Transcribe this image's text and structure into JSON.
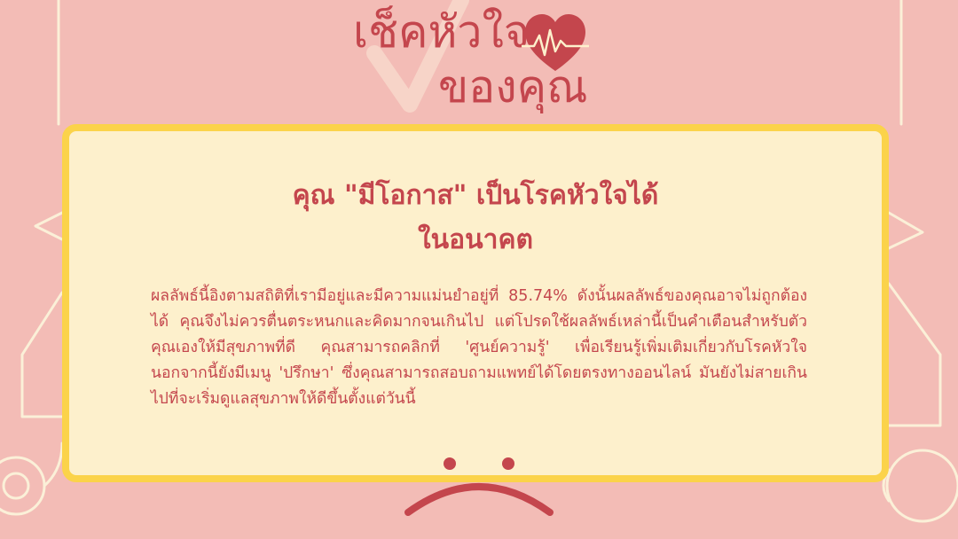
{
  "title": {
    "line1": "เช็คหัวใจ",
    "line2": "ของคุณ"
  },
  "result": {
    "headline_line1": "คุณ \"มีโอกาส\" เป็นโรคหัวใจได้",
    "headline_line2": "ในอนาคต",
    "body": "ผลลัพธ์นี้อิงตามสถิติที่เรามีอยู่และมีความแม่นยำอยู่ที่ 85.74% ดังนั้นผลลัพธ์ของคุณอาจไม่ถูกต้องได้ คุณจึงไม่ควรตื่นตระหนกและคิดมากจนเกินไป แต่โปรดใช้ผลลัพธ์เหล่านี้เป็นคำเตือนสำหรับตัวคุณเองให้มีสุขภาพที่ดี คุณสามารถคลิกที่ 'ศูนย์ความรู้' เพื่อเรียนรู้เพิ่มเติมเกี่ยวกับโรคหัวใจ นอกจากนี้ยังมีเมนู 'ปรึกษา' ซึ่งคุณสามารถสอบถามแพทย์ได้โดยตรงทางออนไลน์ มันยังไม่สายเกินไปที่จะเริ่มดูแลสุขภาพให้ดีขึ้นตั้งแต่วันนี้"
  },
  "icons": {
    "heart": "heart-pulse-icon",
    "check": "checkmark-icon",
    "face": "sad-face-icon"
  },
  "colors": {
    "background": "#f3bcb6",
    "accent": "#c4464d",
    "card": "#fdf0cc",
    "card_border": "#fbd34a",
    "decor_line": "#fbf0d8"
  }
}
